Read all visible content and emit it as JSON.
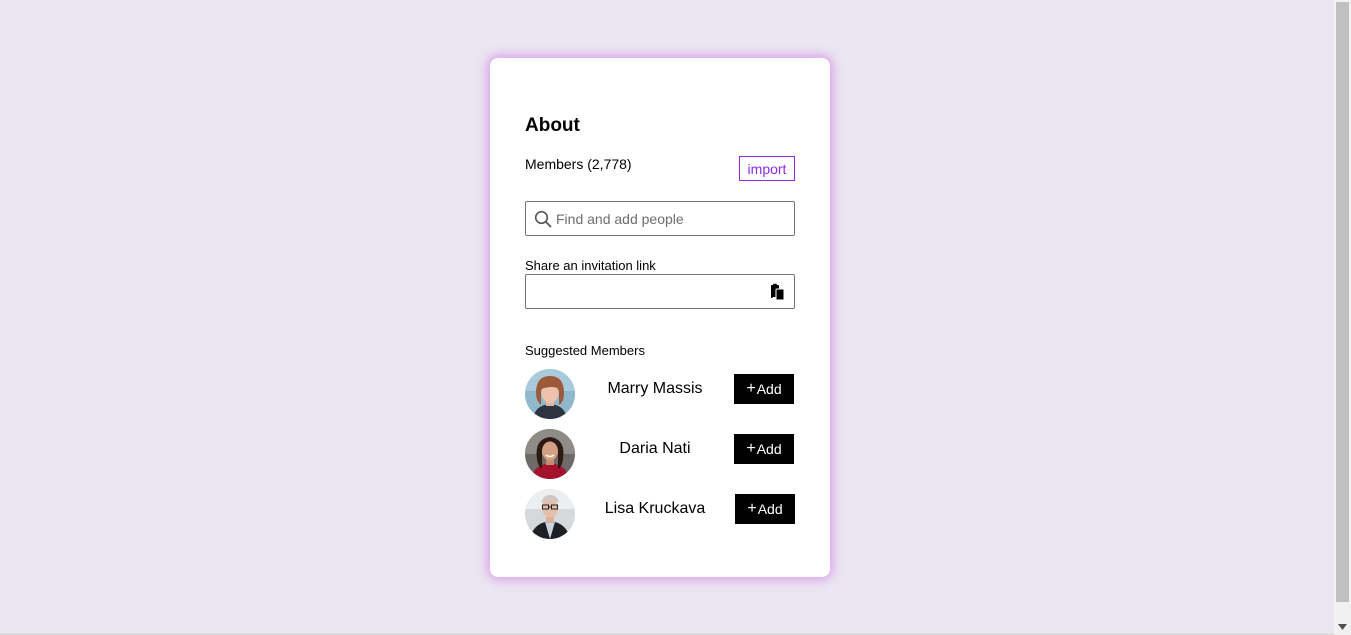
{
  "about": {
    "title": "About",
    "members_count_label": "Members (2,778)",
    "import_label": "import",
    "search": {
      "placeholder": "Find and add people",
      "value": "",
      "icon": "search-icon"
    },
    "share": {
      "label": "Share an invitation link",
      "value": "",
      "copy_icon": "copy-icon"
    },
    "suggested": {
      "label": "Suggested Members",
      "add_plus": "+",
      "add_text": "Add",
      "members": [
        {
          "name": "Marry Massis"
        },
        {
          "name": "Daria Nati"
        },
        {
          "name": "Lisa Kruckava"
        }
      ]
    }
  },
  "colors": {
    "page_background": "#ebe6f2",
    "card_glow": "#d68ce6",
    "accent": "#8a2be2",
    "button": "#000000"
  }
}
